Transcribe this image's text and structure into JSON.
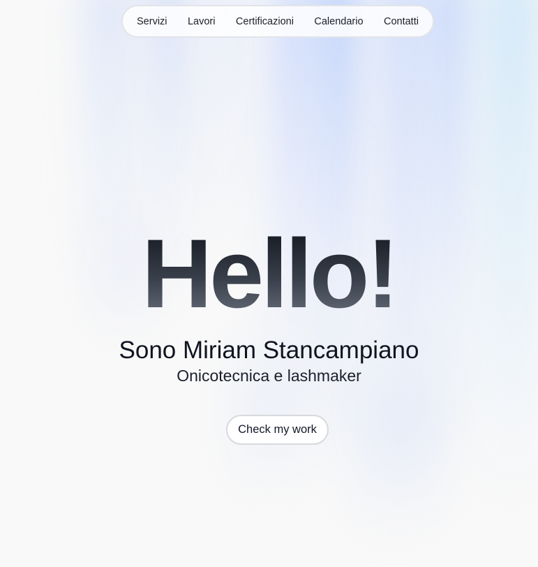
{
  "nav": {
    "items": [
      {
        "label": "Servizi"
      },
      {
        "label": "Lavori"
      },
      {
        "label": "Certificazioni"
      },
      {
        "label": "Calendario"
      },
      {
        "label": "Contatti"
      }
    ]
  },
  "hero": {
    "greeting": "Hello!",
    "name": "Sono Miriam Stancampiano",
    "subtitle": "Onicotecnica e lashmaker",
    "cta_label": "Check my work"
  },
  "colors": {
    "background": "#f9f9f9",
    "accent_aurora": "#b0c8fc",
    "text": "#0f1420"
  }
}
